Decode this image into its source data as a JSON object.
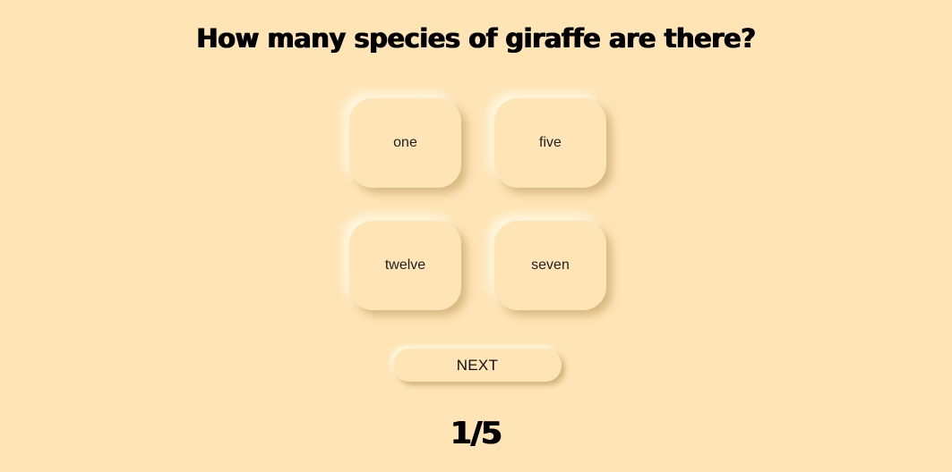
{
  "quiz": {
    "question": "How many species of giraffe are there?",
    "answers": [
      "one",
      "five",
      "twelve",
      "seven"
    ],
    "next_label": "NEXT",
    "progress": "1/5",
    "current_question": 1,
    "total_questions": 5
  },
  "colors": {
    "background": "#ffe4b5",
    "text": "#000000"
  }
}
